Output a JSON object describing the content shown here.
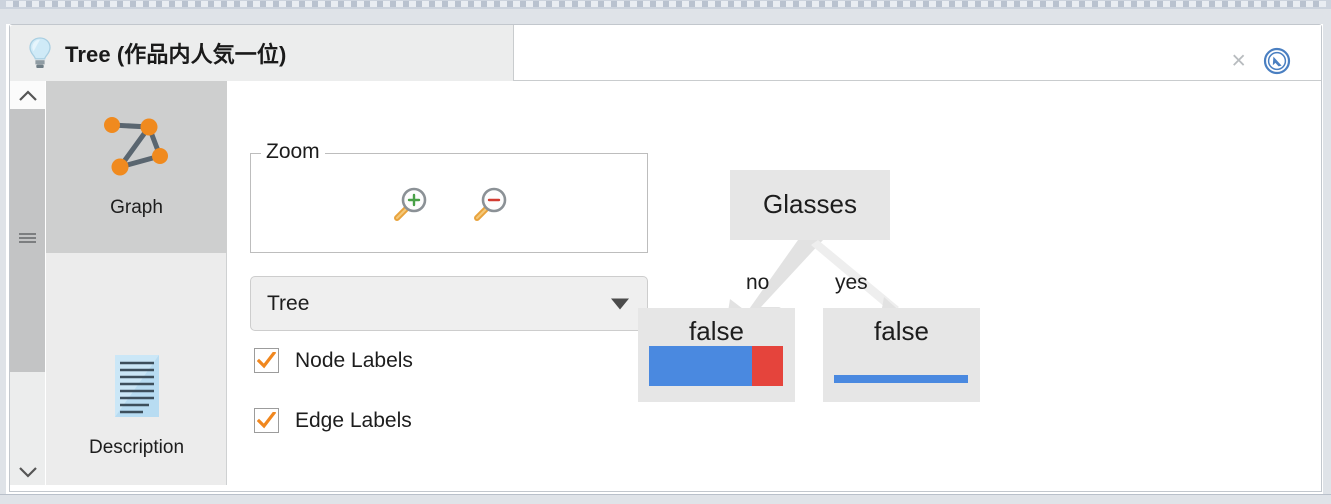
{
  "window": {
    "tab": {
      "icon": "lightbulb-icon",
      "title": "Tree (作品内人気一位)",
      "close_label": "×",
      "detach_icon": "detach-arrow-icon"
    }
  },
  "sidebar": {
    "items": [
      {
        "icon": "graph-network-icon",
        "label": "Graph",
        "selected": true
      },
      {
        "icon": "description-document-icon",
        "label": "Description",
        "selected": false
      }
    ],
    "scroll_up_icon": "chevron-up-icon",
    "scroll_down_icon": "chevron-down-icon",
    "scroll_grip_icon": "grip-lines-icon"
  },
  "controls": {
    "zoom_group_title": "Zoom",
    "zoom_in": {
      "icon": "magnifier-plus-icon",
      "label": "Zoom In"
    },
    "zoom_out": {
      "icon": "magnifier-minus-icon",
      "label": "Zoom Out"
    },
    "layout_select": {
      "value": "Tree",
      "arrow_icon": "triangle-down-icon",
      "options": [
        "Tree"
      ]
    },
    "checkboxes": [
      {
        "label": "Node Labels",
        "checked": true,
        "check_icon": "checkmark-icon"
      },
      {
        "label": "Edge Labels",
        "checked": true,
        "check_icon": "checkmark-icon"
      }
    ]
  },
  "colors": {
    "bar_blue": "#4a89e0",
    "bar_red": "#e5443c",
    "check_orange": "#f0871f",
    "node_fill": "#e6e6e6",
    "edge_gray": "#e2e2e2",
    "selected_sidebar": "#cecfcf"
  },
  "chart_data": {
    "type": "tree",
    "title": "Tree (作品内人気一位)",
    "layout": "Tree",
    "node_labels_shown": true,
    "edge_labels_shown": true,
    "nodes": [
      {
        "id": "root",
        "label": "Glasses",
        "type": "split",
        "distribution": null
      },
      {
        "id": "left",
        "label": "false",
        "type": "leaf",
        "distribution": [
          {
            "class": "false",
            "fraction": 0.77,
            "color": "#4a89e0"
          },
          {
            "class": "true",
            "fraction": 0.23,
            "color": "#e5443c"
          }
        ]
      },
      {
        "id": "right",
        "label": "false",
        "type": "leaf",
        "distribution": [
          {
            "class": "false",
            "fraction": 1.0,
            "color": "#4a89e0"
          }
        ]
      }
    ],
    "edges": [
      {
        "from": "root",
        "to": "left",
        "label": "no"
      },
      {
        "from": "root",
        "to": "right",
        "label": "yes"
      }
    ]
  }
}
